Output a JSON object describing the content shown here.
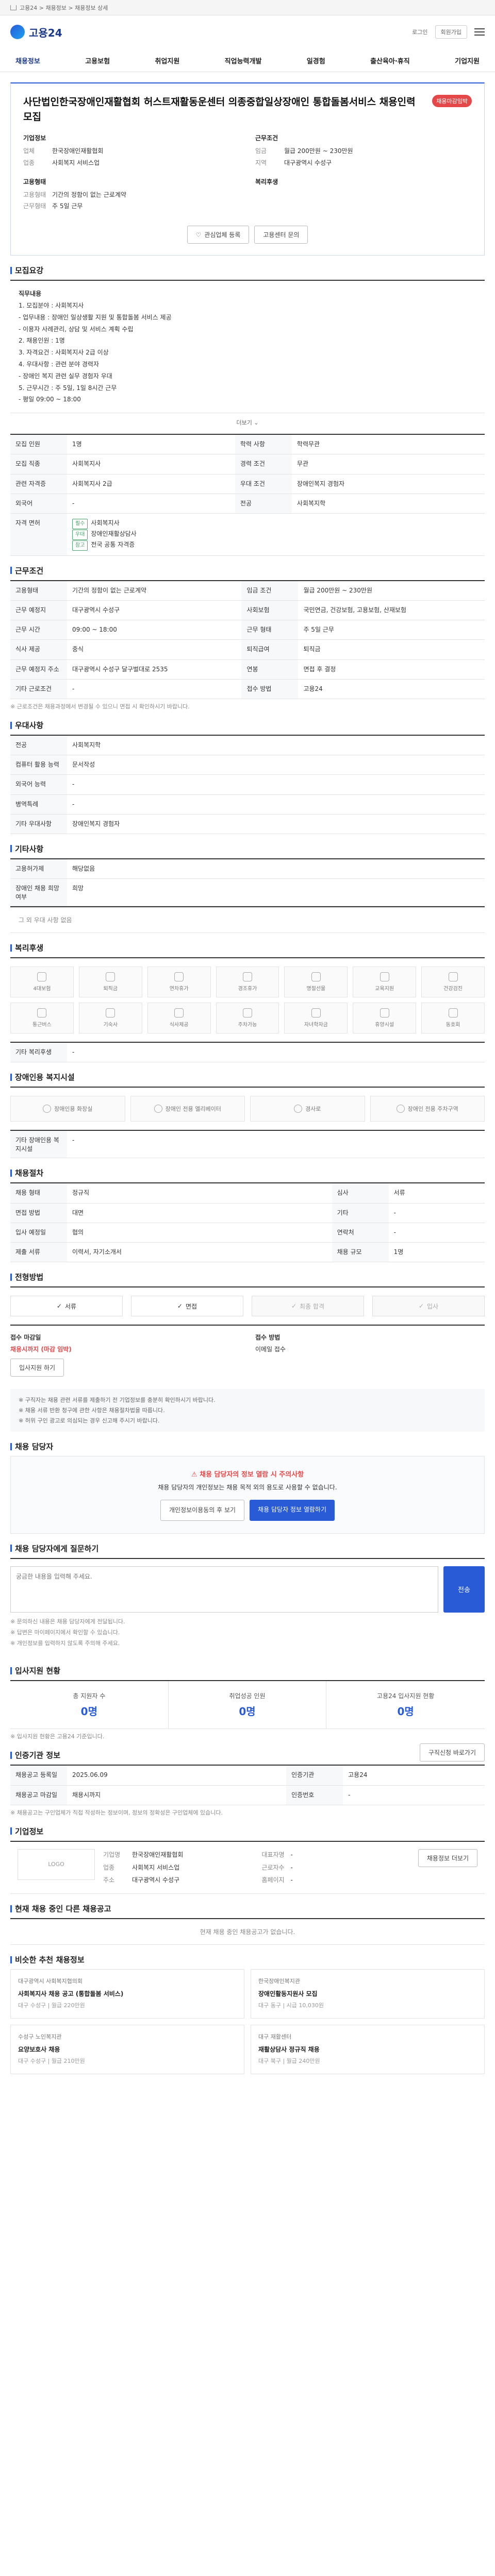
{
  "util": {
    "path": "고용24 > 채용정보 > 채용정보 상세"
  },
  "header": {
    "logo": "고용24",
    "login": "로그인",
    "join": "회원가입"
  },
  "gnb": [
    "채용정보",
    "고용보험",
    "취업지원",
    "직업능력개발",
    "일경험",
    "출산육아·휴직",
    "기업지원"
  ],
  "job": {
    "title": "사단법인한국장애인재활협회 허스트재활동운센터 의종중합일상장애인 통합돌봄서비스 채용인력모집",
    "badge": "채용마감임박",
    "company_h": "기업정보",
    "company_rows": [
      [
        "업체",
        "한국장애인재활협회"
      ],
      [
        "업종",
        "사회복지 서비스업"
      ]
    ],
    "cond_h": "근무조건",
    "cond_rows": [
      [
        "임금",
        "월급 200만원 ~ 230만원"
      ],
      [
        "지역",
        "대구광역시 수성구"
      ]
    ],
    "recruit_h": "고용형태",
    "recruit_rows": [
      [
        "고용형태",
        "기간의 정함이 없는 근로계약"
      ],
      [
        "근무형태",
        "주 5일 근무"
      ]
    ],
    "welfare_h": "복리후생",
    "btn_interest": "관심업체 등록",
    "btn_report": "고용센터 문의"
  },
  "jobdesc": {
    "title": "모집요강",
    "heading": "직무내용",
    "lines": [
      "1. 모집분야 : 사회복지사",
      "- 업무내용 : 장애인 일상생활 지원 및 통합돌봄 서비스 제공",
      "- 이용자 사례관리, 상담 및 서비스 계획 수립",
      "2. 채용인원 : 1명",
      "3. 자격요건 : 사회복지사 2급 이상",
      "4. 우대사항 : 관련 분야 경력자",
      "- 장애인 복지 관련 실무 경험자 우대",
      "5. 근무시간 : 주 5일, 1일 8시간 근무",
      "- 평일 09:00 ~ 18:00"
    ],
    "more": "더보기"
  },
  "jobinfo": {
    "rows": [
      [
        "모집 인원",
        "1명",
        "학력 사항",
        "학력무관"
      ],
      [
        "모집 직종",
        "사회복지사",
        "경력 조건",
        "무관"
      ],
      [
        "관련 자격증",
        "사회복지사 2급",
        "우대 조건",
        "장애인복지 경험자"
      ],
      [
        "외국어",
        "-",
        "전공",
        "사회복지학"
      ]
    ],
    "cert_h": "자격 면허",
    "certs": [
      [
        "필수",
        "사회복지사"
      ],
      [
        "우대",
        "장애인재활상담사"
      ],
      [
        "참고",
        "전국 공통 자격증"
      ]
    ]
  },
  "work": {
    "title": "근무조건",
    "rows": [
      [
        "고용형태",
        "기간의 정함이 없는 근로계약",
        "임금 조건",
        "월급 200만원 ~ 230만원"
      ],
      [
        "근무 예정지",
        "대구광역시 수성구",
        "사회보험",
        "국민연금, 건강보험, 고용보험, 산재보험"
      ],
      [
        "근무 시간",
        "09:00 ~ 18:00",
        "근무 형태",
        "주 5일 근무"
      ],
      [
        "식사 제공",
        "중식",
        "퇴직급여",
        "퇴직금"
      ],
      [
        "근무 예정지 주소",
        "대구광역시 수성구 달구벌대로 2535",
        "연봉",
        "면접 후 결정"
      ],
      [
        "기타 근로조건",
        "-",
        "접수 방법",
        "고용24"
      ]
    ],
    "note": "※ 근로조건은 채용과정에서 변경될 수 있으니 면접 시 확인하시기 바랍니다."
  },
  "prefer": {
    "title": "우대사항",
    "rows": [
      [
        "전공",
        "사회복지학"
      ],
      [
        "컴퓨터 활용 능력",
        "문서작성"
      ],
      [
        "외국어 능력",
        "-"
      ],
      [
        "병역특례",
        "-"
      ],
      [
        "기타 우대사항",
        "장애인복지 경험자"
      ]
    ]
  },
  "etc": {
    "title": "기타사항",
    "rows": [
      [
        "고용허가제",
        "해당없음"
      ],
      [
        "장애인 채용 희망 여부",
        "희망"
      ]
    ],
    "extra": "그 외 우대 사항 없음"
  },
  "welfare": {
    "title": "복리후생",
    "items": [
      "4대보험",
      "퇴직금",
      "연차휴가",
      "경조휴가",
      "명절선물",
      "교육지원",
      "건강검진",
      "통근버스",
      "기숙사",
      "식사제공",
      "주차가능",
      "자녀학자금",
      "휴양시설",
      "동호회"
    ],
    "extra_h": "기타 복리후생",
    "extra": "-"
  },
  "disab": {
    "title": "장애인용 복지시설",
    "items": [
      "장애인용 화장실",
      "장애인 전용 엘리베이터",
      "경사로",
      "장애인 전용 주차구역"
    ],
    "extra_h": "기타 장애인용 복지시설",
    "extra": "-"
  },
  "process": {
    "title": "채용절차",
    "steps": [
      "서류",
      "면접",
      "최종 합격",
      "입사"
    ],
    "rows": [
      [
        "채용 형태",
        "정규직",
        "심사",
        "서류"
      ],
      [
        "면접 방법",
        "대면",
        "기타",
        "-"
      ],
      [
        "입사 예정일",
        "협의",
        "연락처",
        "-"
      ],
      [
        "제출 서류",
        "이력서, 자기소개서",
        "채용 규모",
        "1명"
      ]
    ]
  },
  "apply": {
    "title": "전형방법",
    "c1_h": "접수 마감일",
    "c1": "채용시까지 (마감 임박)",
    "c2_h": "접수 방법",
    "c2": "이메일 접수",
    "btn": "입사지원 하기",
    "notes": [
      "※ 구직자는 채용 관련 서류를 제출하기 전 기업정보를 충분히 확인하시기 바랍니다.",
      "※ 채용 서류 반환 청구에 관한 사항은 채용절차법을 따릅니다.",
      "※ 허위 구인 광고로 의심되는 경우 신고해 주시기 바랍니다."
    ]
  },
  "contact": {
    "title": "채용 담당자",
    "warn": "채용 담당자의 정보 열람 시 주의사항",
    "body": "채용 담당자의 개인정보는 채용 목적 외의 용도로 사용할 수 없습니다.",
    "btn1": "개인정보이용동의 후 보기",
    "btn2": "채용 담당자 정보 열람하기"
  },
  "inquiry": {
    "title": "채용 담당자에게 질문하기",
    "placeholder": "궁금한 내용을 입력해 주세요.",
    "send": "전송",
    "notes": [
      "※ 문의하신 내용은 채용 담당자에게 전달됩니다.",
      "※ 답변은 마이페이지에서 확인할 수 있습니다.",
      "※ 개인정보를 입력하지 않도록 주의해 주세요."
    ]
  },
  "stats": {
    "title": "입사지원 현황",
    "items": [
      [
        "총 지원자 수",
        "0명"
      ],
      [
        "취업성공 인원",
        "0명"
      ],
      [
        "고용24 입사지원 현황",
        "0명"
      ]
    ],
    "note": "※ 입사지원 현황은 고용24 기준입니다."
  },
  "mgmt": {
    "title": "인증기관 정보",
    "btn": "구직신청 바로가기",
    "rows": [
      [
        "채용공고 등록일",
        "2025.06.09",
        "인증기관",
        "고용24"
      ],
      [
        "채용공고 마감일",
        "채용시까지",
        "인증번호",
        "-"
      ]
    ],
    "note": "※ 채용공고는 구인업체가 직접 작성하는 정보이며, 정보의 정확성은 구인업체에 있습니다."
  },
  "corp": {
    "title": "기업정보",
    "logo": "LOGO",
    "rows": [
      [
        "기업명",
        "한국장애인재활협회"
      ],
      [
        "대표자명",
        "-"
      ],
      [
        "업종",
        "사회복지 서비스업"
      ],
      [
        "근로자수",
        "-"
      ],
      [
        "주소",
        "대구광역시 수성구"
      ],
      [
        "홈페이지",
        "-"
      ]
    ],
    "btn": "채용정보 더보기"
  },
  "cur": {
    "title": "현재 채용 중인 다른 채용공고",
    "msg": "현재 채용 중인 채용공고가 없습니다."
  },
  "recommend": {
    "title": "비슷한 추천 채용정보",
    "cards": [
      {
        "co": "대구광역시 사회복지협의회",
        "t": "사회복지사 채용 공고 (통합돌봄 서비스)",
        "m": "대구 수성구 | 월급 220만원"
      },
      {
        "co": "한국장애인복지관",
        "t": "장애인활동지원사 모집",
        "m": "대구 동구 | 시급 10,030원"
      },
      {
        "co": "수성구 노인복지관",
        "t": "요양보호사 채용",
        "m": "대구 수성구 | 월급 210만원"
      },
      {
        "co": "대구 재활센터",
        "t": "재활상담사 정규직 채용",
        "m": "대구 북구 | 월급 240만원"
      }
    ]
  }
}
